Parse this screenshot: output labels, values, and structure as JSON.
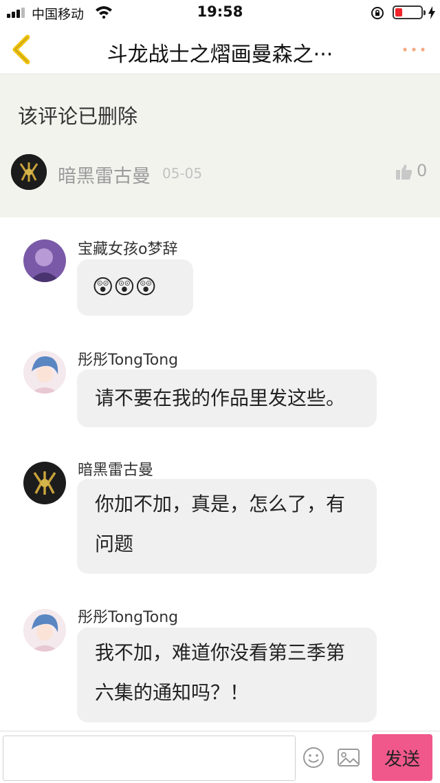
{
  "status_bar": {
    "carrier": "中国移动",
    "time": "19:58"
  },
  "nav": {
    "title": "斗龙战士之熠画曼森之···"
  },
  "parent_comment": {
    "text": "该评论已删除",
    "author": "暗黑雷古曼",
    "date": "05-05",
    "likes": "0"
  },
  "messages": [
    {
      "name": "宝藏女孩o梦辞",
      "text": "😲😲😲"
    },
    {
      "name": "彤彤TongTong",
      "text": "请不要在我的作品里发这些。"
    },
    {
      "name": "暗黑雷古曼",
      "line1": "你加不加，真是，怎么了，有",
      "line2": "问题"
    },
    {
      "name": "彤彤TongTong",
      "line1": "我不加，难道你没看第三季第",
      "line2": "六集的通知吗？！"
    }
  ],
  "input": {
    "value": "",
    "send_label": "发送"
  },
  "colors": {
    "accent_back": "#f1c40f",
    "more_dots": "#f5a97f",
    "send_button": "#f0588b",
    "battery_low": "#f0242a"
  }
}
